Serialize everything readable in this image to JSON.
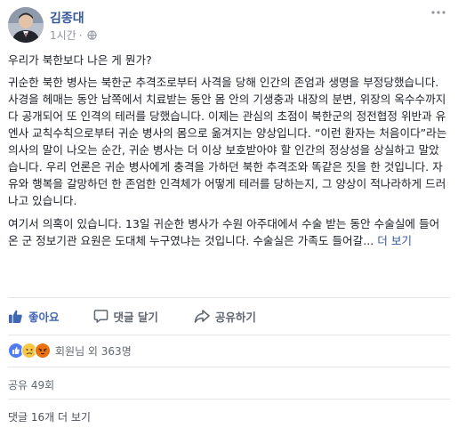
{
  "post": {
    "author": "김종대",
    "time": "1시간",
    "privacy_icon": "globe-icon",
    "more_icon": "ellipsis-icon",
    "heading": "우리가 북한보다 나은 게 뭔가?",
    "paragraph1": "귀순한 북한 병사는 북한군 추격조로부터 사격을 당해 인간의 존엄과 생명을 부정당했습니다. 사경을 헤매는 동안 남쪽에서 치료받는 동안 몸 안의 기생충과 내장의 분변, 위장의 옥수수까지 다 공개되어 또 인격의 테러를 당했습니다. 이제는 관심의 초점이 북한군의 정전협정 위반과 유엔사 교칙수칙으로부터 귀순 병사의 몸으로 옮겨지는 양상입니다. “이런 환자는 처음이다”라는 의사의 말이 나오는 순간, 귀순 병사는 더 이상 보호받아야 할 인간의 정상성을 상실하고 말았습니다. 우리 언론은 귀순 병사에게 충격을 가하던 북한 추격조와 똑같은 짓을 한 것입니다. 자유와 행복을 갈망하던 한 존엄한 인격체가 어떻게 테러를 당하는지, 그 양상이 적나라하게 드러나고 있습니다.",
    "paragraph2": "여기서 의혹이 있습니다. 13일 귀순한 병사가 수원 아주대에서 수술 받는 동안 수술실에 들어 온 군 정보기관 요원은 도대체 누구였냐는 것입니다. 수술실은 가족도 들어갈...",
    "see_more": "더 보기"
  },
  "actions": {
    "like": "좋아요",
    "comment": "댓글 달기",
    "share": "공유하기"
  },
  "reactions": {
    "icons": [
      "like-reaction-icon",
      "sad-reaction-icon",
      "angry-reaction-icon"
    ],
    "text": "회원님 외 363명"
  },
  "shares": "공유 49회",
  "comments": "댓글 16개 더 보기",
  "colors": {
    "link": "#365899",
    "like_blue": "#4267b2",
    "muted": "#90949c"
  }
}
